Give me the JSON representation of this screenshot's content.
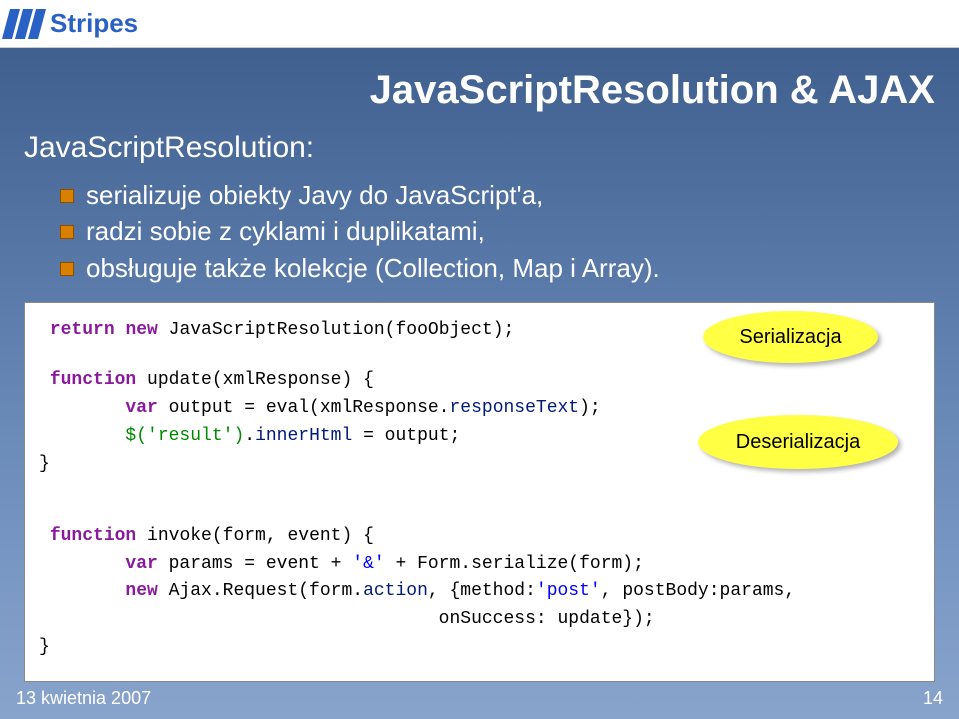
{
  "header": {
    "logo_text": "Stripes"
  },
  "title": "JavaScriptResolution & AJAX",
  "subtitle": "JavaScriptResolution:",
  "bullets": [
    "serializuje obiekty Javy do JavaScript'a,",
    "radzi sobie z cyklami i duplikatami,",
    "obsługuje także kolekcje (Collection, Map i Array)."
  ],
  "code": {
    "line1": {
      "kw_return": "return",
      "kw_new": "new",
      "rest": " JavaScriptResolution(fooObject);"
    },
    "line2": {
      "kw_function": "function",
      "name": " update(xmlResponse) {"
    },
    "line3": {
      "indent": "        ",
      "kw_var": "var",
      "rest1": " output = eval(xmlResponse.",
      "prop": "responseText",
      "rest2": ");"
    },
    "line4": {
      "indent": "        ",
      "jq": "$('result')",
      "rest1": ".",
      "prop": "innerHtml",
      "rest2": " = output;"
    },
    "line5": "}",
    "line6": {
      "kw_function": "function",
      "name": " invoke(form, event) {"
    },
    "line7": {
      "indent": "        ",
      "kw_var": "var",
      "rest1": " params = event + ",
      "str1": "'&'",
      "rest2": " + Form.serialize(form);"
    },
    "line8": {
      "indent": "        ",
      "kw_new": "new",
      "rest1": " Ajax.Request(form.",
      "prop": "action",
      "rest2": ", {method:",
      "str1": "'post'",
      "rest3": ", postBody:params,"
    },
    "line9": {
      "indent": "                                     ",
      "rest": "onSuccess: update});"
    },
    "line10": "}"
  },
  "callouts": {
    "serial": "Serializacja",
    "deserial": "Deserializacja"
  },
  "footer": {
    "date": "13 kwietnia 2007",
    "page": "14"
  }
}
